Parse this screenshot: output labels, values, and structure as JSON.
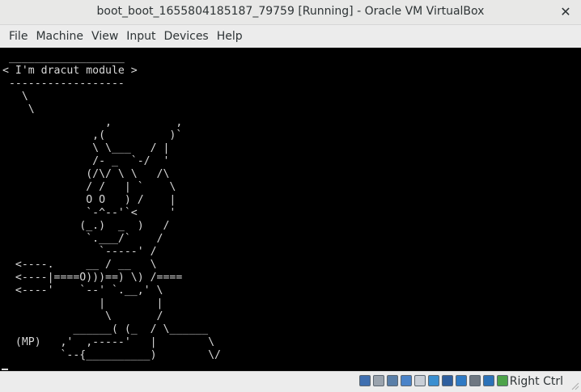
{
  "window": {
    "title": "boot_boot_1655804185187_79759 [Running] - Oracle VM VirtualBox",
    "close_glyph": "✕"
  },
  "menu": {
    "items": [
      "File",
      "Machine",
      "View",
      "Input",
      "Devices",
      "Help"
    ]
  },
  "console": {
    "lines": [
      " __________________",
      "< I'm dracut module >",
      " ------------------",
      "   \\",
      "    \\",
      "                ,          ,",
      "              ,(          )`",
      "              \\ \\___   / |",
      "              /- _  `-/  '",
      "             (/\\/ \\ \\   /\\",
      "             / /   | `    \\",
      "             O O   ) /    |",
      "             `-^--'`<     '",
      "            (_.)  _  )   /",
      "             `.___/`    /",
      "               `-----' /",
      "  <----.     __ / __   \\",
      "  <----|====O)))==) \\) /====",
      "  <----'    `--' `.__,' \\",
      "               |        |",
      "                \\       /",
      "           ______( (_  / \\______",
      "  (MP)   ,'  ,-----'   |        \\",
      "         `--{__________)        \\/"
    ]
  },
  "status": {
    "host_key": "Right Ctrl",
    "icons": [
      {
        "name": "hard-disk-icon",
        "color": "#3f6fb0"
      },
      {
        "name": "optical-drive-icon",
        "color": "#9aa3ad"
      },
      {
        "name": "audio-icon",
        "color": "#5a7fa8"
      },
      {
        "name": "network-icon",
        "color": "#4a83c8"
      },
      {
        "name": "usb-icon",
        "color": "#c8ced6"
      },
      {
        "name": "shared-folders-icon",
        "color": "#3a8fd0"
      },
      {
        "name": "display-icon",
        "color": "#2f5f9e"
      },
      {
        "name": "video-capture-icon",
        "color": "#2f7ac4"
      },
      {
        "name": "recording-icon",
        "color": "#6e7781"
      },
      {
        "name": "cpu-icon",
        "color": "#2c72b8"
      },
      {
        "name": "mouse-integration-icon",
        "color": "#4da34a"
      }
    ]
  }
}
